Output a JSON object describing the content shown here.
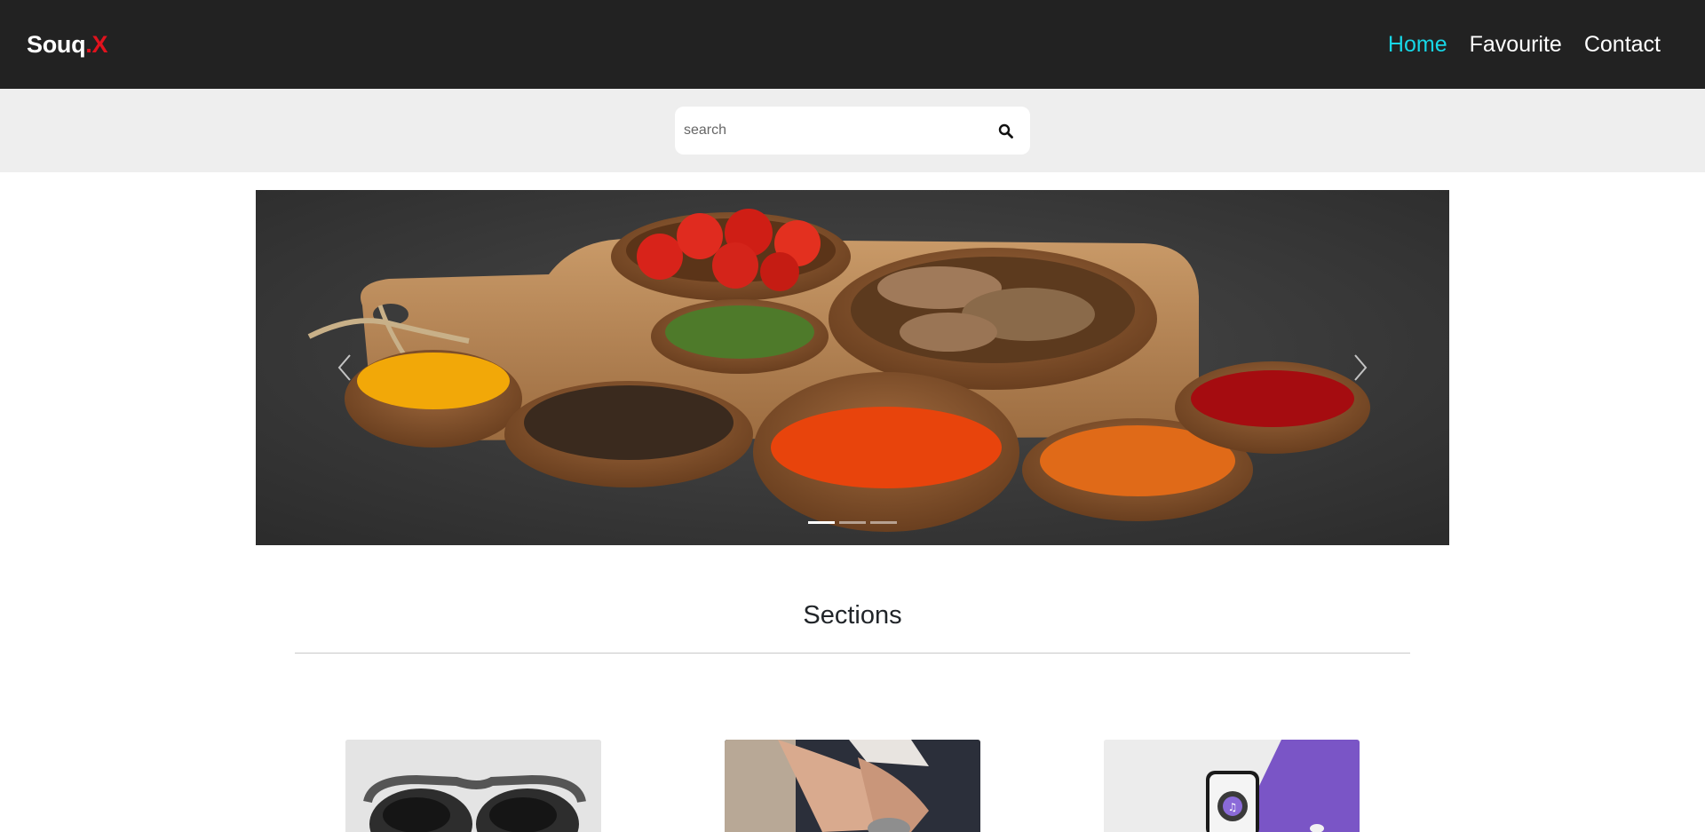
{
  "navbar": {
    "brand_main": "Souq",
    "brand_dot": ".",
    "brand_x": "X",
    "links": [
      {
        "label": "Home",
        "active": true
      },
      {
        "label": "Favourite",
        "active": false
      },
      {
        "label": "Contact",
        "active": false
      }
    ],
    "accent_color": "#17d6e6",
    "brand_x_color": "#e0121d",
    "background": "#222222"
  },
  "search": {
    "placeholder": "search",
    "icon": "search-icon"
  },
  "carousel": {
    "image_subject": "spices in wooden bowls on a cutting board",
    "slide_count": 3,
    "active_slide": 1,
    "prev_icon": "chevron-left-icon",
    "next_icon": "chevron-right-icon"
  },
  "sections": {
    "title": "Sections",
    "cards": [
      {
        "image": "sunglasses"
      },
      {
        "image": "wristwatch"
      },
      {
        "image": "smartphone"
      }
    ]
  }
}
